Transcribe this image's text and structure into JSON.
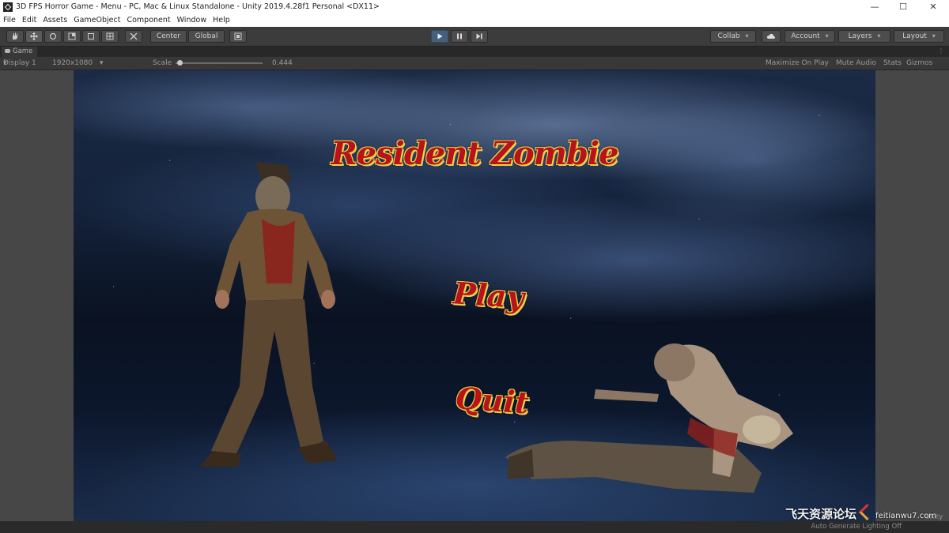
{
  "window": {
    "title": "3D FPS Horror Game - Menu - PC, Mac & Linux Standalone - Unity 2019.4.28f1 Personal <DX11>",
    "controls": {
      "minimize": "—",
      "maximize": "☐",
      "close": "✕"
    }
  },
  "menubar": [
    "File",
    "Edit",
    "Assets",
    "GameObject",
    "Component",
    "Window",
    "Help"
  ],
  "toolbar": {
    "pivot_center": "Center",
    "pivot_global": "Global",
    "collab": "Collab",
    "account": "Account",
    "layers": "Layers",
    "layout": "Layout",
    "play_active": true
  },
  "game_tab": {
    "label": "Game"
  },
  "game_controls": {
    "display": "Display 1",
    "resolution": "1920x1080",
    "scale_label": "Scale",
    "scale_value": "0.444",
    "maximize_on_play": "Maximize On Play",
    "mute_audio": "Mute Audio",
    "stats": "Stats",
    "gizmos": "Gizmos"
  },
  "game_screen": {
    "title": "Resident Zombie",
    "play": "Play",
    "quit": "Quit"
  },
  "status": {
    "lighting": "Auto Generate Lighting Off",
    "engine_mark": "Unity"
  },
  "watermark": {
    "site": "飞天资源论坛",
    "url": "feitianwu7.com"
  },
  "colors": {
    "title_red": "#b8121a",
    "title_outline": "#e8d24a",
    "play_active": "#46607c"
  }
}
